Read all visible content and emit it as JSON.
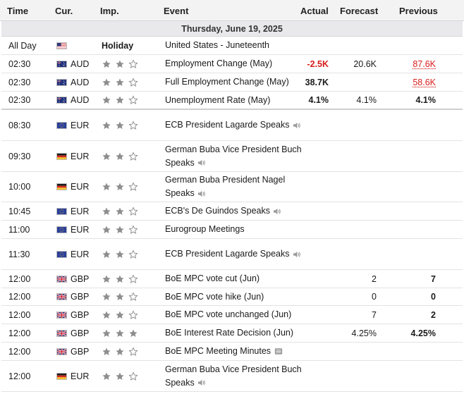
{
  "header": {
    "time": "Time",
    "cur": "Cur.",
    "imp": "Imp.",
    "event": "Event",
    "actual": "Actual",
    "forecast": "Forecast",
    "previous": "Previous"
  },
  "day_label": "Thursday, June 19, 2025",
  "rows": [
    {
      "time": "All Day",
      "flag": "us",
      "cur": "",
      "imp_label": "Holiday",
      "stars": 0,
      "event": "United States - Juneteenth",
      "actual": "",
      "forecast": "",
      "previous": ""
    },
    {
      "time": "02:30",
      "flag": "au",
      "cur": "AUD",
      "stars": 2,
      "event": "Employment Change (May)",
      "actual": "-2.5K",
      "forecast": "20.6K",
      "previous": "87.6K"
    },
    {
      "time": "02:30",
      "flag": "au",
      "cur": "AUD",
      "stars": 2,
      "event": "Full Employment Change (May)",
      "actual": "38.7K",
      "forecast": "",
      "previous": "58.6K"
    },
    {
      "time": "02:30",
      "flag": "au",
      "cur": "AUD",
      "stars": 2,
      "event": "Unemployment Rate (May)",
      "actual": "4.1%",
      "forecast": "4.1%",
      "previous": "4.1%"
    },
    {
      "time": "08:30",
      "flag": "eu",
      "cur": "EUR",
      "stars": 2,
      "event": "ECB President Lagarde Speaks",
      "actual": "",
      "forecast": "",
      "previous": ""
    },
    {
      "time": "09:30",
      "flag": "de",
      "cur": "EUR",
      "stars": 2,
      "event": "German Buba Vice President Buch Speaks",
      "actual": "",
      "forecast": "",
      "previous": ""
    },
    {
      "time": "10:00",
      "flag": "de",
      "cur": "EUR",
      "stars": 2,
      "event": "German Buba President Nagel Speaks",
      "actual": "",
      "forecast": "",
      "previous": ""
    },
    {
      "time": "10:45",
      "flag": "eu",
      "cur": "EUR",
      "stars": 2,
      "event": "ECB's De Guindos Speaks",
      "actual": "",
      "forecast": "",
      "previous": ""
    },
    {
      "time": "11:00",
      "flag": "eu",
      "cur": "EUR",
      "stars": 2,
      "event": "Eurogroup Meetings",
      "actual": "",
      "forecast": "",
      "previous": ""
    },
    {
      "time": "11:30",
      "flag": "eu",
      "cur": "EUR",
      "stars": 2,
      "event": "ECB President Lagarde Speaks",
      "actual": "",
      "forecast": "",
      "previous": ""
    },
    {
      "time": "12:00",
      "flag": "gb",
      "cur": "GBP",
      "stars": 2,
      "event": "BoE MPC vote cut (Jun)",
      "actual": "",
      "forecast": "2",
      "previous": "7"
    },
    {
      "time": "12:00",
      "flag": "gb",
      "cur": "GBP",
      "stars": 2,
      "event": "BoE MPC vote hike (Jun)",
      "actual": "",
      "forecast": "0",
      "previous": "0"
    },
    {
      "time": "12:00",
      "flag": "gb",
      "cur": "GBP",
      "stars": 2,
      "event": "BoE MPC vote unchanged (Jun)",
      "actual": "",
      "forecast": "7",
      "previous": "2"
    },
    {
      "time": "12:00",
      "flag": "gb",
      "cur": "GBP",
      "stars": 3,
      "event": "BoE Interest Rate Decision (Jun)",
      "actual": "",
      "forecast": "4.25%",
      "previous": "4.25%"
    },
    {
      "time": "12:00",
      "flag": "gb",
      "cur": "GBP",
      "stars": 2,
      "event": "BoE MPC Meeting Minutes",
      "actual": "",
      "forecast": "",
      "previous": ""
    },
    {
      "time": "12:00",
      "flag": "de",
      "cur": "EUR",
      "stars": 2,
      "event": "German Buba Vice President Buch Speaks",
      "actual": "",
      "forecast": "",
      "previous": ""
    }
  ],
  "row_icons": {
    "4": "speaker-icon",
    "5": "speaker-icon",
    "6": "speaker-icon",
    "7": "speaker-icon",
    "9": "speaker-icon",
    "14": "document-icon",
    "15": "speaker-icon"
  },
  "colors": {
    "negative": "#d91c1c",
    "star_filled": "#8e8e8e",
    "star_empty": "#8e8e8e"
  }
}
